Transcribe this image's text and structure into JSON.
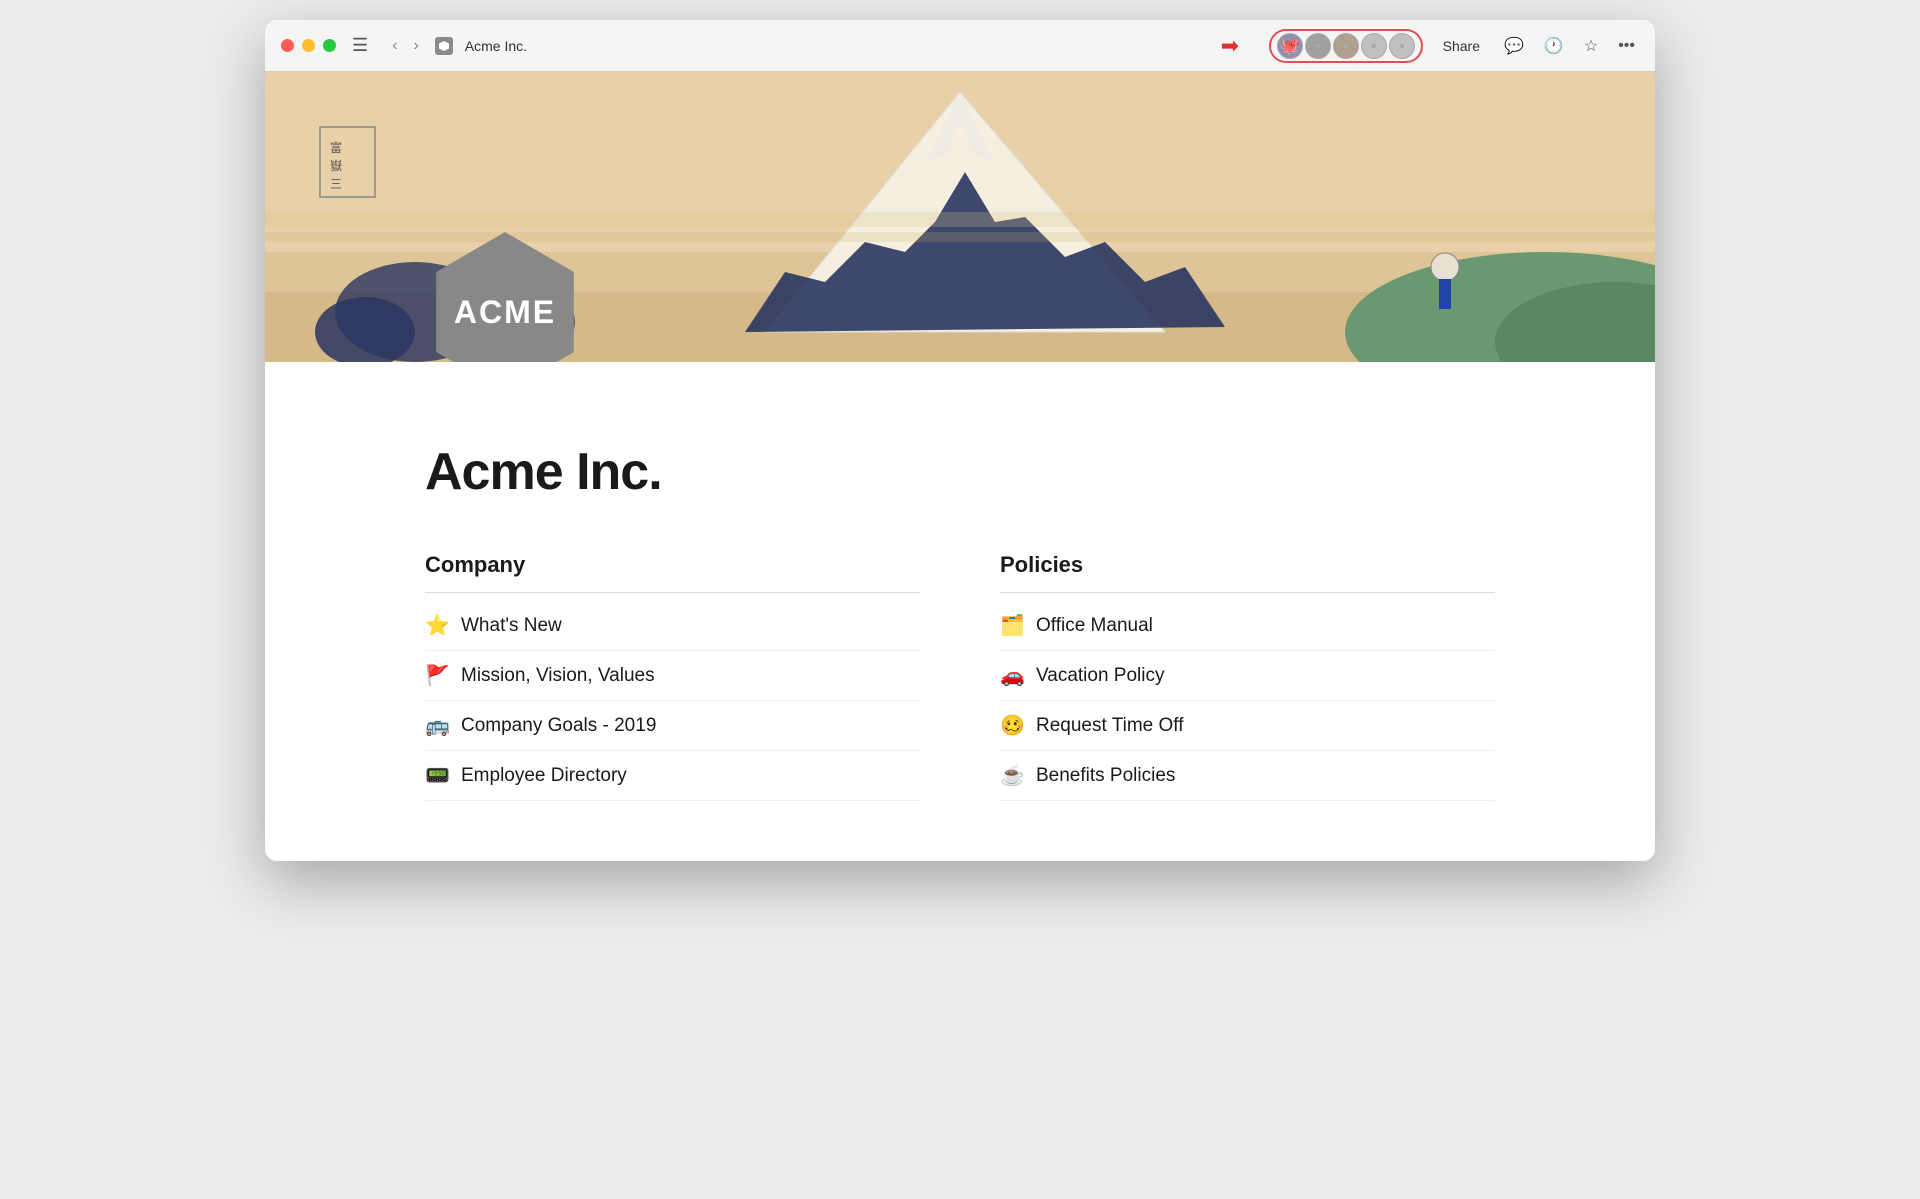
{
  "window": {
    "title": "Acme Inc."
  },
  "titlebar": {
    "back_label": "‹",
    "forward_label": "›",
    "sidebar_icon": "☰",
    "page_icon": "⬡",
    "title": "Acme Inc.",
    "share_label": "Share",
    "comment_icon": "💬",
    "history_icon": "🕐",
    "star_icon": "☆",
    "more_icon": "•••"
  },
  "hero": {
    "logo_text": "ACME"
  },
  "page": {
    "title": "Acme Inc."
  },
  "company_section": {
    "heading": "Company",
    "items": [
      {
        "emoji": "⭐",
        "label": "What's New"
      },
      {
        "emoji": "🚩",
        "label": "Mission, Vision, Values"
      },
      {
        "emoji": "🚌",
        "label": "Company Goals - 2019"
      },
      {
        "emoji": "📟",
        "label": "Employee Directory"
      }
    ]
  },
  "policies_section": {
    "heading": "Policies",
    "items": [
      {
        "emoji": "🗂️",
        "label": "Office Manual"
      },
      {
        "emoji": "🚗",
        "label": "Vacation Policy"
      },
      {
        "emoji": "🥴",
        "label": "Request Time Off"
      },
      {
        "emoji": "☕",
        "label": "Benefits Policies"
      }
    ]
  },
  "colors": {
    "accent_red": "#e03030",
    "title_dark": "#1a1a1a",
    "section_bg": "#ffffff"
  }
}
